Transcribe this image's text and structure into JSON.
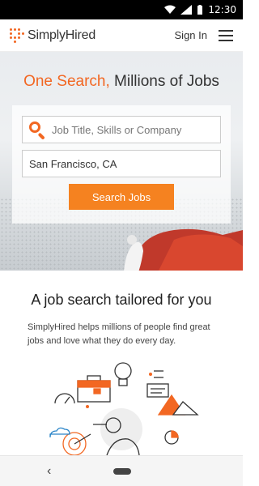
{
  "status_bar": {
    "time": "12:30"
  },
  "header": {
    "brand": "SimplyHired",
    "signin": "Sign In"
  },
  "hero": {
    "title_accent": "One Search,",
    "title_rest": " Millions of Jobs",
    "keyword_placeholder": "Job Title, Skills or Company",
    "location_value": "San Francisco, CA",
    "search_button": "Search Jobs"
  },
  "content": {
    "tagline": "A job search tailored for you",
    "description": "SimplyHired helps millions of people find great jobs and love what they do every day."
  },
  "colors": {
    "accent": "#f26722",
    "button": "#f58220"
  }
}
